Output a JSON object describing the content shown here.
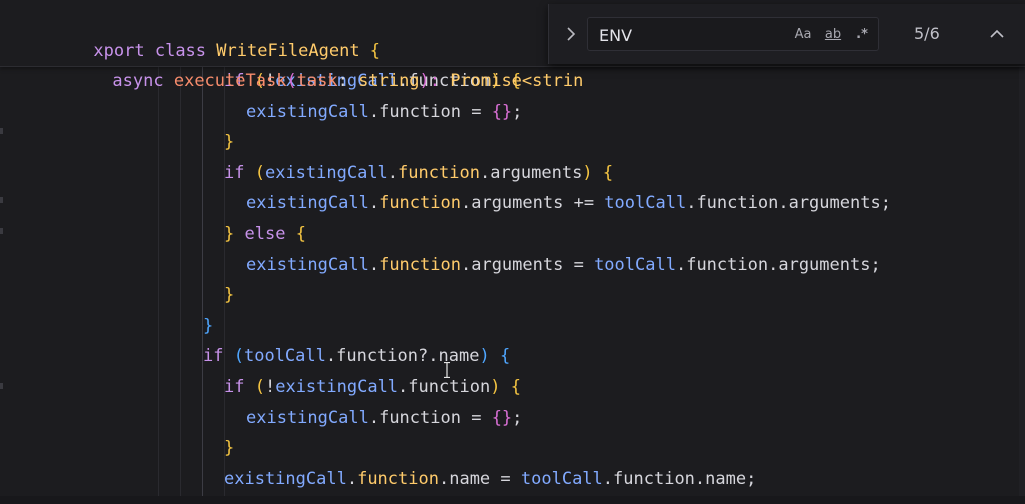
{
  "sticky_scroll": {
    "line1": {
      "t1": "xport",
      "t2": " class ",
      "t3": "WriteFileAgent",
      "t4": " {"
    },
    "line2": {
      "t1": "async ",
      "t2": "executeTask",
      "t3": "(",
      "t4": "task",
      "t5": ": ",
      "t6": "string",
      "t7": "): ",
      "t8": "Promise",
      "t9": "<strin"
    }
  },
  "code_lines": [
    {
      "indent": 224,
      "tokens": [
        [
          "ctl",
          "if "
        ],
        [
          "br1",
          "("
        ],
        [
          "op",
          "!"
        ],
        [
          "var",
          "existingCall"
        ],
        [
          "op",
          "."
        ],
        [
          "plain",
          "function"
        ],
        [
          "br1",
          ")"
        ],
        [
          "op",
          " "
        ],
        [
          "br1",
          "{"
        ]
      ]
    },
    {
      "indent": 246,
      "tokens": [
        [
          "var",
          "existingCall"
        ],
        [
          "op",
          "."
        ],
        [
          "plain",
          "function"
        ],
        [
          "op",
          " = "
        ],
        [
          "br2",
          "{}"
        ],
        [
          "op",
          ";"
        ]
      ]
    },
    {
      "indent": 224,
      "tokens": [
        [
          "br1",
          "}"
        ]
      ]
    },
    {
      "indent": 224,
      "tokens": [
        [
          "ctl",
          "if "
        ],
        [
          "br1",
          "("
        ],
        [
          "var",
          "existingCall"
        ],
        [
          "op",
          "."
        ],
        [
          "prop",
          "function"
        ],
        [
          "op",
          "."
        ],
        [
          "plain",
          "arguments"
        ],
        [
          "br1",
          ")"
        ],
        [
          "op",
          " "
        ],
        [
          "br1",
          "{"
        ]
      ]
    },
    {
      "indent": 246,
      "tokens": [
        [
          "var",
          "existingCall"
        ],
        [
          "op",
          "."
        ],
        [
          "prop",
          "function"
        ],
        [
          "op",
          "."
        ],
        [
          "plain",
          "arguments"
        ],
        [
          "op",
          " += "
        ],
        [
          "var",
          "toolCall"
        ],
        [
          "op",
          "."
        ],
        [
          "plain",
          "function"
        ],
        [
          "op",
          "."
        ],
        [
          "plain",
          "arguments"
        ],
        [
          "op",
          ";"
        ]
      ]
    },
    {
      "indent": 224,
      "tokens": [
        [
          "br1",
          "}"
        ],
        [
          "op",
          " "
        ],
        [
          "ctl",
          "else"
        ],
        [
          "op",
          " "
        ],
        [
          "br1",
          "{"
        ]
      ]
    },
    {
      "indent": 246,
      "tokens": [
        [
          "var",
          "existingCall"
        ],
        [
          "op",
          "."
        ],
        [
          "prop",
          "function"
        ],
        [
          "op",
          "."
        ],
        [
          "plain",
          "arguments"
        ],
        [
          "op",
          " = "
        ],
        [
          "var",
          "toolCall"
        ],
        [
          "op",
          "."
        ],
        [
          "plain",
          "function"
        ],
        [
          "op",
          "."
        ],
        [
          "plain",
          "arguments"
        ],
        [
          "op",
          ";"
        ]
      ]
    },
    {
      "indent": 224,
      "tokens": [
        [
          "br1",
          "}"
        ]
      ]
    },
    {
      "indent": 203,
      "tokens": [
        [
          "br3",
          "}"
        ]
      ]
    },
    {
      "indent": 203,
      "tokens": [
        [
          "ctl",
          "if "
        ],
        [
          "br3",
          "("
        ],
        [
          "var",
          "toolCall"
        ],
        [
          "op",
          "."
        ],
        [
          "plain",
          "function"
        ],
        [
          "op",
          "?."
        ],
        [
          "plain",
          "name"
        ],
        [
          "br3",
          ")"
        ],
        [
          "op",
          " "
        ],
        [
          "br3",
          "{"
        ]
      ]
    },
    {
      "indent": 224,
      "tokens": [
        [
          "ctl",
          "if "
        ],
        [
          "br1",
          "("
        ],
        [
          "op",
          "!"
        ],
        [
          "var",
          "existingCall"
        ],
        [
          "op",
          "."
        ],
        [
          "plain",
          "function"
        ],
        [
          "br1",
          ")"
        ],
        [
          "op",
          " "
        ],
        [
          "br1",
          "{"
        ]
      ]
    },
    {
      "indent": 246,
      "tokens": [
        [
          "var",
          "existingCall"
        ],
        [
          "op",
          "."
        ],
        [
          "plain",
          "function"
        ],
        [
          "op",
          " = "
        ],
        [
          "br2",
          "{}"
        ],
        [
          "op",
          ";"
        ]
      ]
    },
    {
      "indent": 224,
      "tokens": [
        [
          "br1",
          "}"
        ]
      ]
    },
    {
      "indent": 224,
      "tokens": [
        [
          "var",
          "existingCall"
        ],
        [
          "op",
          "."
        ],
        [
          "prop",
          "function"
        ],
        [
          "op",
          "."
        ],
        [
          "plain",
          "name"
        ],
        [
          "op",
          " = "
        ],
        [
          "var",
          "toolCall"
        ],
        [
          "op",
          "."
        ],
        [
          "plain",
          "function"
        ],
        [
          "op",
          "."
        ],
        [
          "plain",
          "name"
        ],
        [
          "op",
          ";"
        ]
      ]
    }
  ],
  "find_widget": {
    "toggle_icon": "chevron-right-icon",
    "query": "ENV",
    "match_case_label": "Aa",
    "whole_word_label": "ab",
    "regex_label": ".*",
    "match_count": "5/6",
    "prev_icon": "chevron-up-icon"
  },
  "colors": {
    "background": "#1c1c1f",
    "keyword": "#c792ea",
    "class_name": "#ffcb6b",
    "function_name": "#f78c6c",
    "variable": "#82aaff"
  }
}
